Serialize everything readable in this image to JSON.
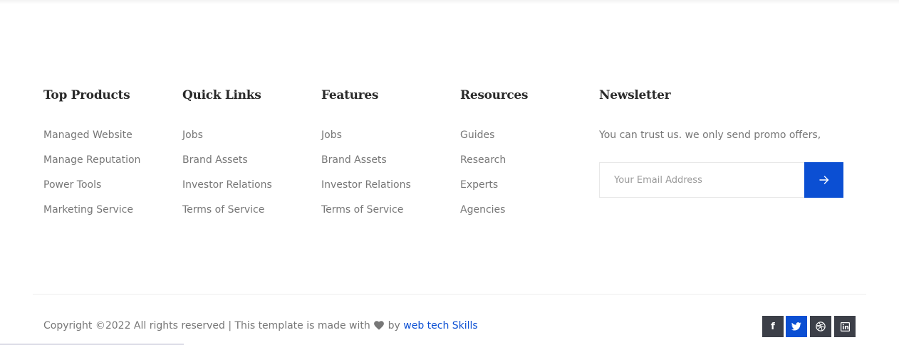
{
  "columns": [
    {
      "heading": "Top Products",
      "items": [
        "Managed Website",
        "Manage Reputation",
        "Power Tools",
        "Marketing Service"
      ]
    },
    {
      "heading": "Quick Links",
      "items": [
        "Jobs",
        "Brand Assets",
        "Investor Relations",
        "Terms of Service"
      ]
    },
    {
      "heading": "Features",
      "items": [
        "Jobs",
        "Brand Assets",
        "Investor Relations",
        "Terms of Service"
      ]
    },
    {
      "heading": "Resources",
      "items": [
        "Guides",
        "Research",
        "Experts",
        "Agencies"
      ]
    }
  ],
  "newsletter": {
    "heading": "Newsletter",
    "text": "You can trust us. we only send promo offers,",
    "email_placeholder": "Your Email Address",
    "submit_icon": "arrow-right-icon"
  },
  "footer": {
    "copyright_prefix": "Copyright ©2022 All rights reserved | This template is made with",
    "heart_icon": "heart-icon",
    "by_text": "by",
    "author_link": "web tech Skills",
    "social": [
      {
        "name": "facebook-icon",
        "glyph": "f",
        "active": false
      },
      {
        "name": "twitter-icon",
        "glyph": "",
        "active": true
      },
      {
        "name": "dribbble-icon",
        "glyph": "",
        "active": false
      },
      {
        "name": "linkedin-icon",
        "glyph": "in",
        "active": false
      }
    ]
  },
  "colors": {
    "accent": "#0b4fd3",
    "heading": "#2a2a2a",
    "text": "#777777",
    "social_bg": "#3c3f48"
  }
}
